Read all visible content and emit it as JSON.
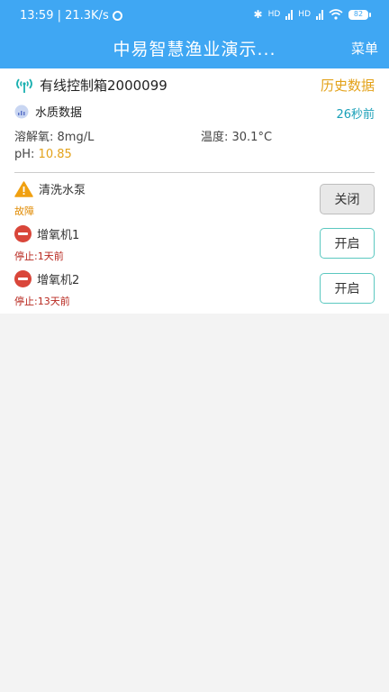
{
  "status_bar": {
    "time_speed": "13:59 | 21.3K/s",
    "hd1": "HD",
    "hd2": "HD",
    "battery": "82"
  },
  "header": {
    "title": "中易智慧渔业演示...",
    "menu_label": "菜单"
  },
  "device": {
    "name": "有线控制箱2000099",
    "history_label": "历史数据"
  },
  "water_quality": {
    "title": "水质数据",
    "updated": "26秒前",
    "dissolved_oxygen": "溶解氧: 8mg/L",
    "temperature": "温度: 30.1°C",
    "ph_label": "pH: ",
    "ph_value": "10.85"
  },
  "equipment": [
    {
      "name": "清洗水泵",
      "status": "故障",
      "button": "关闭",
      "state": "fault"
    },
    {
      "name": "增氧机1",
      "status": "停止:1天前",
      "button": "开启",
      "state": "stopped"
    },
    {
      "name": "增氧机2",
      "status": "停止:13天前",
      "button": "开启",
      "state": "stopped"
    }
  ],
  "colors": {
    "header_bg": "#3fa7f3",
    "accent_orange": "#e3a21a",
    "accent_teal": "#1aa0b8",
    "stop_red": "#d9463a"
  }
}
